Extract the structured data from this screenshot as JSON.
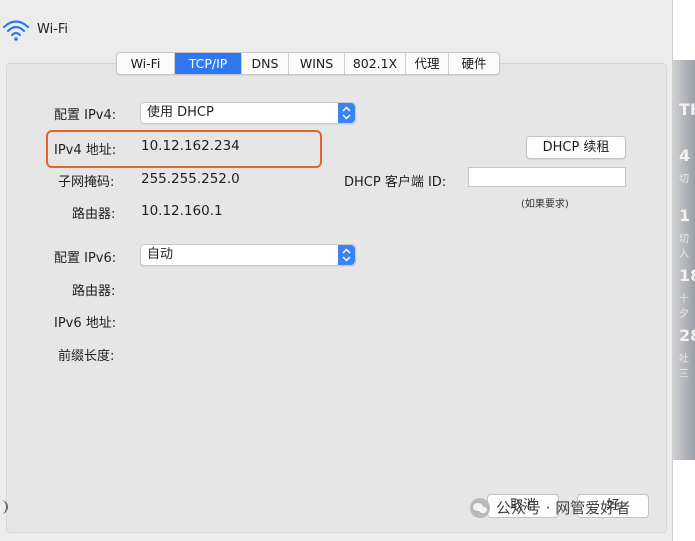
{
  "window": {
    "title": "Wi-Fi"
  },
  "tabs": [
    {
      "label": "Wi-Fi",
      "active": false
    },
    {
      "label": "TCP/IP",
      "active": true
    },
    {
      "label": "DNS",
      "active": false
    },
    {
      "label": "WINS",
      "active": false
    },
    {
      "label": "802.1X",
      "active": false
    },
    {
      "label": "代理",
      "active": false
    },
    {
      "label": "硬件",
      "active": false
    }
  ],
  "ipv4": {
    "config_label": "配置 IPv4:",
    "config_value": "使用 DHCP",
    "address_label": "IPv4 地址:",
    "address_value": "10.12.162.234",
    "subnet_label": "子网掩码:",
    "subnet_value": "255.255.252.0",
    "router_label": "路由器:",
    "router_value": "10.12.160.1"
  },
  "dhcp": {
    "renew_button": "DHCP 续租",
    "client_id_label": "DHCP 客户端 ID:",
    "client_id_value": "",
    "client_id_hint": "(如果要求)"
  },
  "ipv6": {
    "config_label": "配置 IPv6:",
    "config_value": "自动",
    "router_label": "路由器:",
    "address_label": "IPv6 地址:",
    "prefix_label": "前缀长度:"
  },
  "footer": {
    "cancel_button": "取消",
    "ok_button": "好",
    "watermark": "公众号 · 网管爱好者"
  },
  "right_strip": [
    "TH",
    "4",
    "切",
    "1",
    "切入",
    "18",
    "十夕",
    "28",
    "吐三"
  ],
  "colors": {
    "accent": "#2f78ef",
    "highlight": "#e4632f"
  }
}
